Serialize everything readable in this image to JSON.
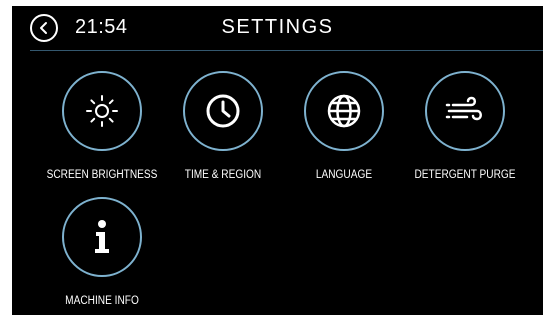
{
  "header": {
    "time": "21:54",
    "title": "SETTINGS"
  },
  "settings_items": [
    {
      "label": "SCREEN BRIGHTNESS",
      "icon": "sun-icon"
    },
    {
      "label": "TIME & REGION",
      "icon": "clock-icon"
    },
    {
      "label": "LANGUAGE",
      "icon": "globe-icon"
    },
    {
      "label": "DETERGENT PURGE",
      "icon": "wind-icon"
    },
    {
      "label": "MACHINE INFO",
      "icon": "info-icon"
    }
  ],
  "colors": {
    "background": "#000000",
    "accent_ring": "#7eb2cf",
    "text": "#ffffff"
  }
}
